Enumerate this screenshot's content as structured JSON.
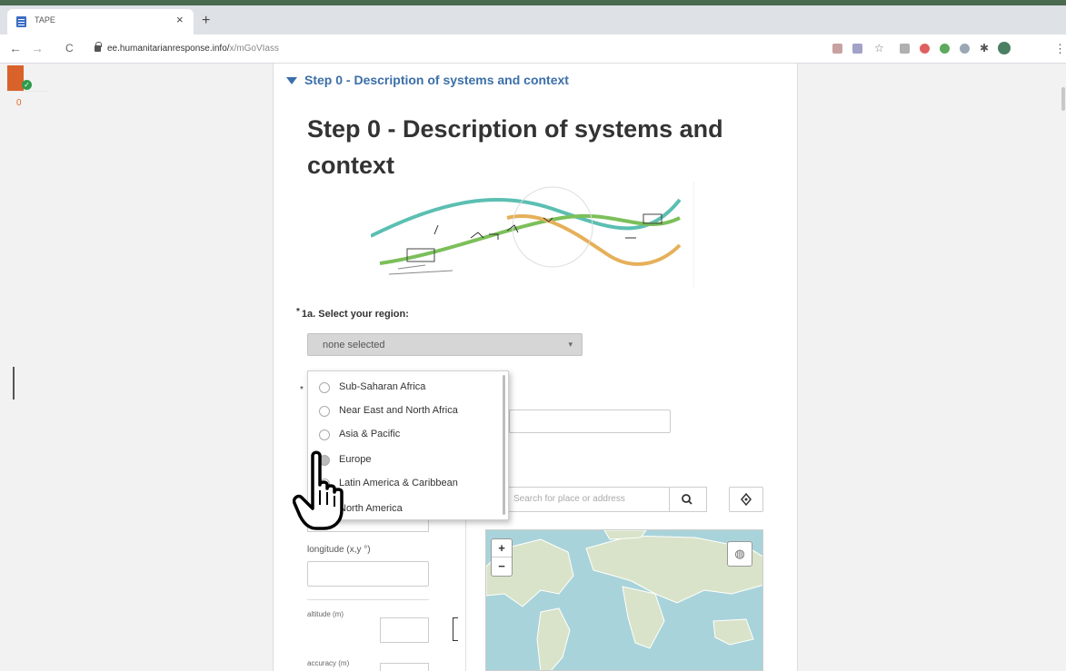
{
  "browser": {
    "tab_title": "TAPE",
    "tab_close": "×",
    "new_tab": "+",
    "url_domain": "ee.humanitarianresponse.info/",
    "url_path": "x/mGoVIass",
    "back": "←",
    "forward": "→",
    "reload": "C",
    "menu": "⋮"
  },
  "sidebar": {
    "count": "0"
  },
  "form": {
    "group_header": "Step 0 - Description of systems and context",
    "title": "Step 0 - Description of systems and context",
    "q1": {
      "required_mark": "*",
      "label": "1a. Select your region:",
      "selected": "none selected",
      "caret": "▾",
      "options": [
        {
          "label": "Sub-Saharan Africa"
        },
        {
          "label": "Near East and North Africa"
        },
        {
          "label": "Asia & Pacific"
        },
        {
          "label": "Europe"
        },
        {
          "label": "Latin America & Caribbean"
        },
        {
          "label": "North America"
        }
      ]
    },
    "hidden_star": "*",
    "location": {
      "search_placeholder": "Search for place or address",
      "search_icon": "search-icon",
      "locate_icon": "locate-icon",
      "longitude_label": "longitude (x,y °)",
      "altitude_label": "altitude (m)",
      "accuracy_label": "accuracy (m)",
      "zoom_in": "+",
      "zoom_out": "−",
      "layers": "◍"
    }
  },
  "colors": {
    "accent": "#3b6fa8",
    "badge": "#d9622b",
    "check": "#2e9b4a",
    "map_water": "#a9d3da",
    "map_land": "#d9e3c9"
  }
}
